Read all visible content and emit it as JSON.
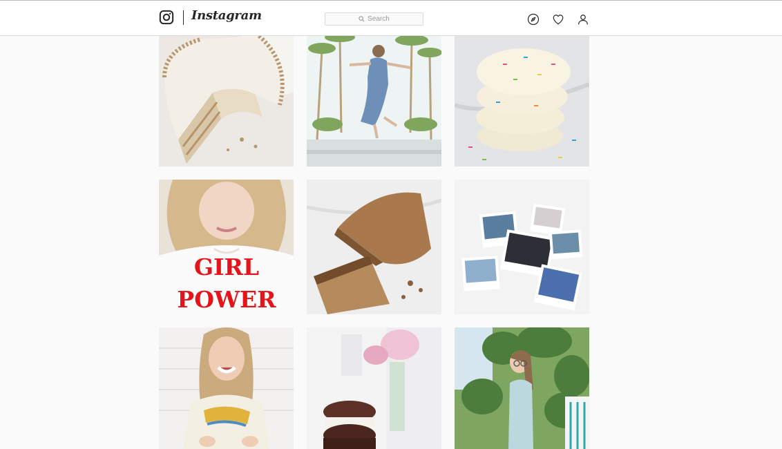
{
  "header": {
    "wordmark": "Instagram",
    "search": {
      "placeholder": "Search"
    },
    "icons": [
      "instagram-logo-icon",
      "compass-icon",
      "heart-icon",
      "profile-icon"
    ]
  },
  "posts": [
    {
      "subject": "cake"
    },
    {
      "subject": "jump"
    },
    {
      "subject": "cookies"
    },
    {
      "subject": "girl-power-shirt",
      "shirt_text": [
        "GIRL",
        "POWER"
      ]
    },
    {
      "subject": "bread"
    },
    {
      "subject": "polaroids"
    },
    {
      "subject": "laughing-woman"
    },
    {
      "subject": "whoopie-pie"
    },
    {
      "subject": "garden-woman"
    }
  ],
  "colors": {
    "background": "#fafafa",
    "header_background": "#ffffff",
    "border": "#dbdbdb",
    "icon": "#262626",
    "placeholder_text": "#999999",
    "shirt_print": "#e4141b"
  }
}
